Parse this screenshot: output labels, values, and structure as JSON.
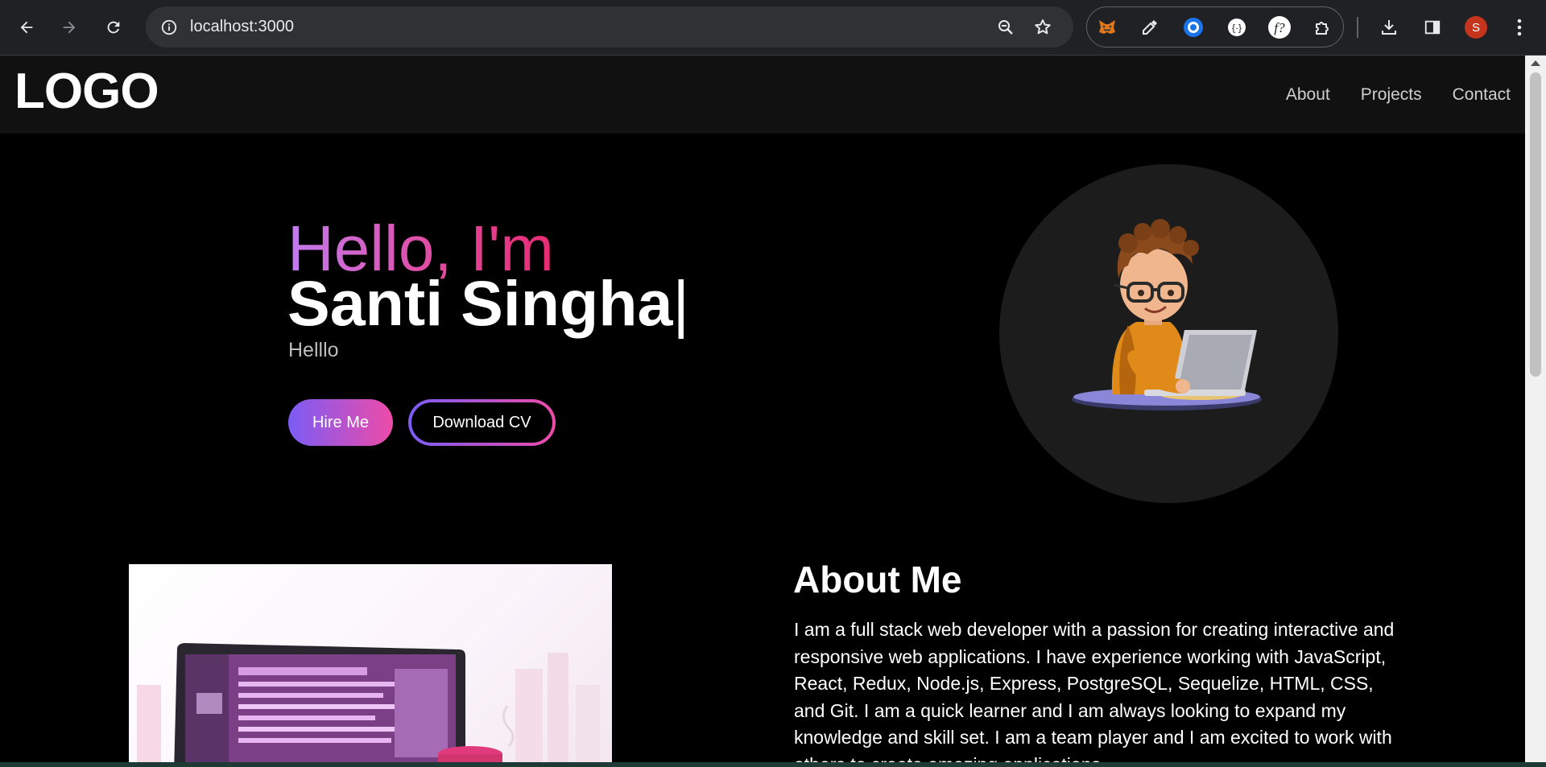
{
  "browser": {
    "url": "localhost:3000",
    "profile_initial": "S",
    "icons": [
      "back-icon",
      "forward-icon",
      "reload-icon",
      "site-info-icon",
      "zoom-icon",
      "bookmark-star-icon",
      "metamask-icon",
      "color-picker-icon",
      "record-icon",
      "code-icon",
      "font-finder-icon",
      "extensions-puzzle-icon",
      "download-icon",
      "side-panel-icon",
      "more-menu-icon"
    ]
  },
  "header": {
    "logo": "LOGO",
    "nav": [
      "About",
      "Projects",
      "Contact"
    ]
  },
  "hero": {
    "greeting": "Hello, I'm",
    "name": "Santi Singha",
    "cursor": "|",
    "subtitle": "Helllo",
    "hire_label": "Hire Me",
    "cv_label": "Download CV"
  },
  "about": {
    "title": "About Me",
    "text": "I am a full stack web developer with a passion for creating interactive and responsive web applications. I have experience working with JavaScript, React, Redux, Node.js, Express, PostgreSQL, Sequelize, HTML, CSS, and Git. I am a quick learner and I am always looking to expand my knowledge and skill set. I am a team player and I am excited to work with others to create amazing applications."
  },
  "colors": {
    "accent_purple": "#7b5cf5",
    "accent_pink": "#ee4ba8",
    "header_bg": "#111111",
    "page_bg": "#000000"
  }
}
